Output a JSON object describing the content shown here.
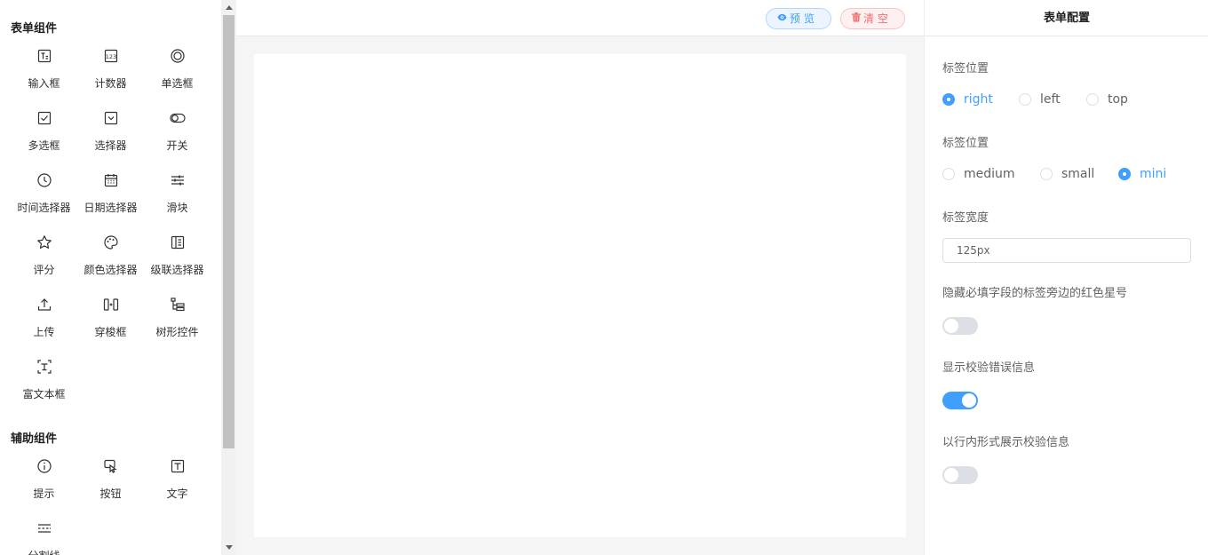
{
  "sidebar": {
    "form_group_title": "表单组件",
    "helper_group_title": "辅助组件",
    "form_items": [
      {
        "label": "输入框",
        "icon": "input-icon"
      },
      {
        "label": "计数器",
        "icon": "counter-icon"
      },
      {
        "label": "单选框",
        "icon": "radio-icon"
      },
      {
        "label": "多选框",
        "icon": "checkbox-icon"
      },
      {
        "label": "选择器",
        "icon": "select-icon"
      },
      {
        "label": "开关",
        "icon": "switch-icon"
      },
      {
        "label": "时间选择器",
        "icon": "clock-icon"
      },
      {
        "label": "日期选择器",
        "icon": "calendar-icon"
      },
      {
        "label": "滑块",
        "icon": "slider-icon"
      },
      {
        "label": "评分",
        "icon": "star-icon"
      },
      {
        "label": "颜色选择器",
        "icon": "palette-icon"
      },
      {
        "label": "级联选择器",
        "icon": "cascader-icon"
      },
      {
        "label": "上传",
        "icon": "upload-icon"
      },
      {
        "label": "穿梭框",
        "icon": "transfer-icon"
      },
      {
        "label": "树形控件",
        "icon": "tree-icon"
      },
      {
        "label": "富文本框",
        "icon": "rich-text-icon"
      }
    ],
    "helper_items": [
      {
        "label": "提示",
        "icon": "info-icon"
      },
      {
        "label": "按钮",
        "icon": "button-icon"
      },
      {
        "label": "文字",
        "icon": "text-icon"
      },
      {
        "label": "分割线",
        "icon": "divider-icon"
      }
    ]
  },
  "toolbar": {
    "preview_label": "预 览",
    "clear_label": "清 空"
  },
  "config": {
    "title": "表单配置",
    "label_position_title": "标签位置",
    "label_position_options": [
      "right",
      "left",
      "top"
    ],
    "label_position_selected": "right",
    "size_title": "标签位置",
    "size_options": [
      "medium",
      "small",
      "mini"
    ],
    "size_selected": "mini",
    "label_width_title": "标签宽度",
    "label_width_value": "125px",
    "hide_required_title": "隐藏必填字段的标签旁边的红色星号",
    "hide_required_on": false,
    "show_error_title": "显示校验错误信息",
    "show_error_on": true,
    "inline_error_title": "以行内形式展示校验信息",
    "inline_error_on": false
  },
  "colors": {
    "primary": "#409eff",
    "danger": "#f56c6c",
    "canvas_bg": "#f5f5f5"
  }
}
